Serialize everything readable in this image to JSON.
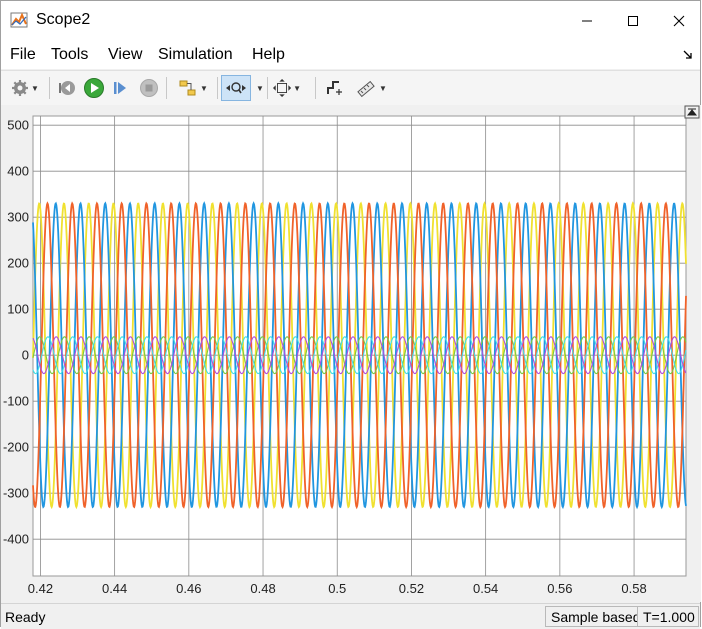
{
  "window": {
    "title": "Scope2",
    "icon": "matlab-scope-icon"
  },
  "menu": {
    "items": [
      "File",
      "Tools",
      "View",
      "Simulation",
      "Help"
    ]
  },
  "toolbar": {
    "buttons": [
      "settings-icon",
      "step-back-icon",
      "run-icon",
      "step-forward-icon",
      "stop-icon",
      "highlight-simulink-block-icon",
      "zoom-x-icon",
      "scale-axes-icon",
      "cursor-measure-icon",
      "triggers-icon"
    ],
    "pressed": "zoom-x-icon"
  },
  "status": {
    "left": "Ready",
    "mode": "Sample based",
    "time": "T=1.000"
  },
  "chart_data": {
    "type": "line",
    "title": "",
    "xlabel": "",
    "ylabel": "",
    "xlim": [
      0.418,
      0.594
    ],
    "ylim": [
      -480,
      520
    ],
    "xticks": [
      0.42,
      0.44,
      0.46,
      0.48,
      0.5,
      0.52,
      0.54,
      0.56,
      0.58
    ],
    "xtick_labels": [
      "0.42",
      "0.44",
      "0.46",
      "0.48",
      "0.5",
      "0.52",
      "0.54",
      "0.56",
      "0.58"
    ],
    "yticks": [
      -400,
      -300,
      -200,
      -100,
      0,
      100,
      200,
      300,
      400,
      500
    ],
    "ytick_labels": [
      "-400",
      "-300",
      "-200",
      "-100",
      "0",
      "100",
      "200",
      "300",
      "400",
      "500"
    ],
    "grid": true,
    "background": "#ffffff",
    "series": [
      {
        "color": "#f0e130",
        "amplitude": 330,
        "frequency": 150,
        "phase_deg": 107
      },
      {
        "color": "#2196e0",
        "amplitude": 330,
        "frequency": 150,
        "phase_deg": 227
      },
      {
        "color": "#f0622a",
        "amplitude": 330,
        "frequency": 150,
        "phase_deg": 347
      },
      {
        "color": "#7ac943",
        "amplitude": 40,
        "frequency": 150,
        "phase_deg": 100
      },
      {
        "color": "#40e0e8",
        "amplitude": 40,
        "frequency": 150,
        "phase_deg": 340
      },
      {
        "color": "#b04de0",
        "amplitude": 40,
        "frequency": 150,
        "phase_deg": 220
      }
    ]
  }
}
